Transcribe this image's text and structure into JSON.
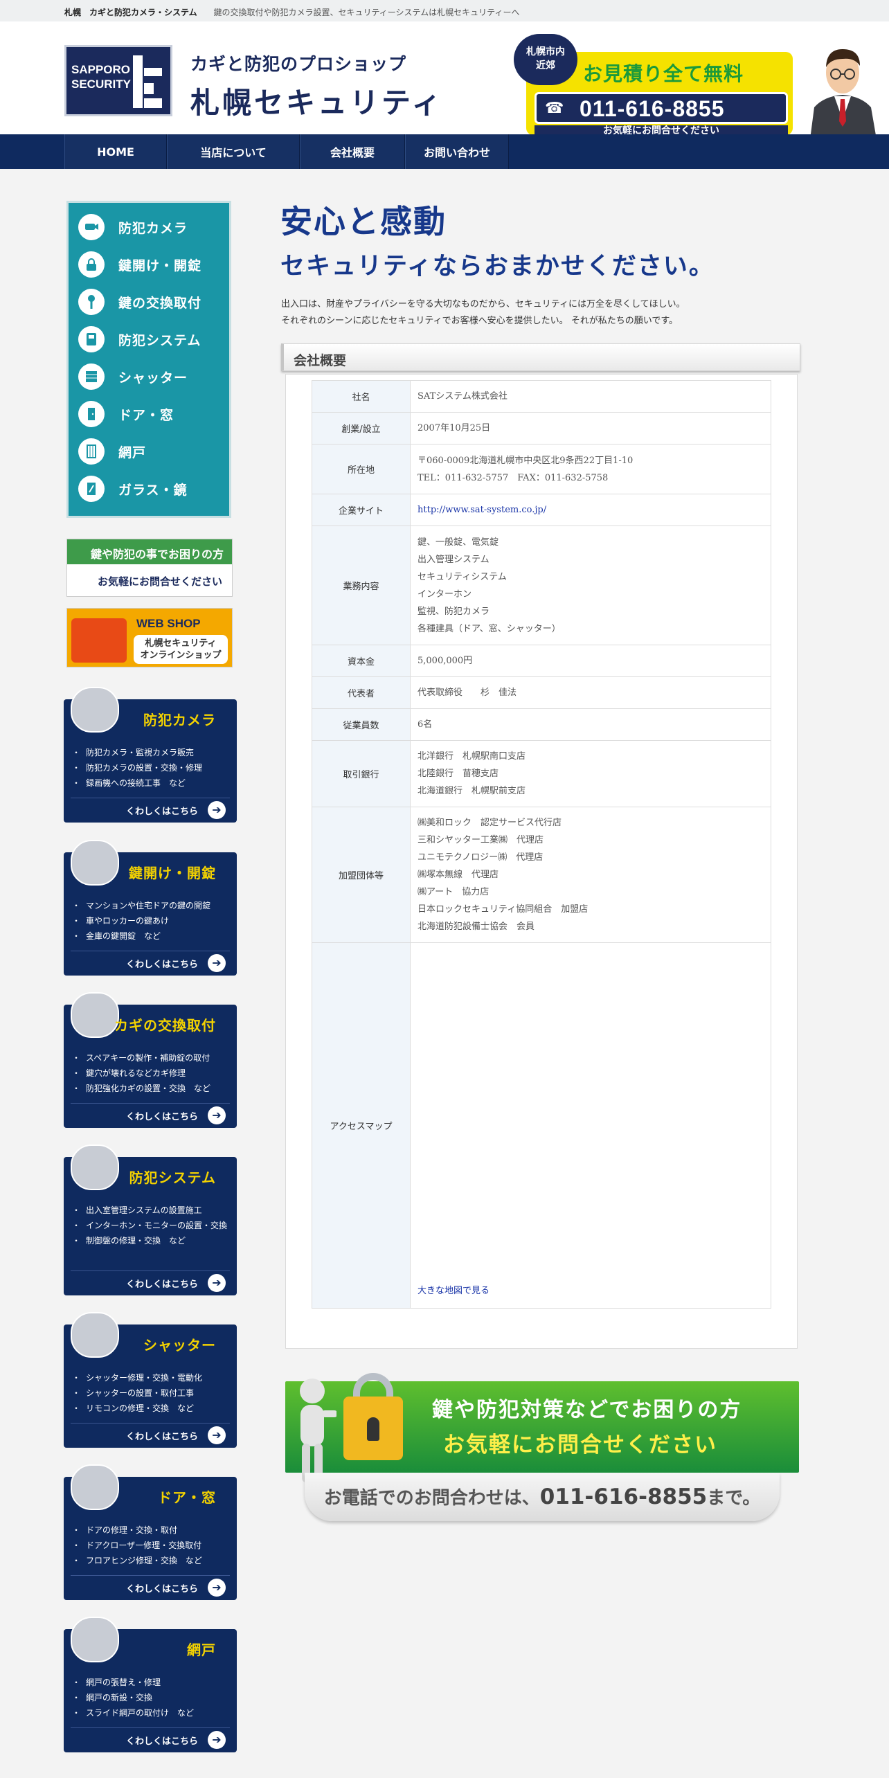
{
  "topbar": {
    "brand": "札幌　カギと防犯カメラ・システム",
    "desc": "鍵の交換取付や防犯カメラ設置、セキュリティーシステムは札幌セキュリティーへ"
  },
  "header": {
    "logo_line1": "SAPPORO",
    "logo_line2": "SECURITY",
    "tagline": "カギと防犯のプロショップ",
    "shop_name": "札幌セキュリティ",
    "area_line1": "札幌市内",
    "area_line2": "近郊",
    "estimate": "お見積り全て無料",
    "phone": "011-616-8855",
    "contact_note": "お気軽にお問合せください"
  },
  "nav": [
    {
      "label": "HOME"
    },
    {
      "label": "当店について"
    },
    {
      "label": "会社概要"
    },
    {
      "label": "お問い合わせ"
    }
  ],
  "side_menu": [
    {
      "label": "防犯カメラ",
      "icon": "camera-icon"
    },
    {
      "label": "鍵開け・開錠",
      "icon": "lock-icon"
    },
    {
      "label": "鍵の交換取付",
      "icon": "key-icon"
    },
    {
      "label": "防犯システム",
      "icon": "intercom-icon"
    },
    {
      "label": "シャッター",
      "icon": "shutter-icon"
    },
    {
      "label": "ドア・窓",
      "icon": "door-icon"
    },
    {
      "label": "網戸",
      "icon": "screen-icon"
    },
    {
      "label": "ガラス・鏡",
      "icon": "glass-icon"
    }
  ],
  "banners": {
    "trouble_title": "鍵や防犯の事でお困りの方",
    "trouble_text": "お気軽にお問合せください",
    "shop_title": "WEB SHOP",
    "shop_sub1": "札幌セキュリティ",
    "shop_sub2": "オンラインショップ"
  },
  "services": [
    {
      "title": "防犯カメラ",
      "items": [
        "防犯カメラ・監視カメラ販売",
        "防犯カメラの設置・交換・修理",
        "録画機への接続工事　など"
      ],
      "more": "くわしくはこちら"
    },
    {
      "title": "鍵開け・開錠",
      "items": [
        "マンションや住宅ドアの鍵の開錠",
        "車やロッカーの鍵あけ",
        "金庫の鍵開錠　など"
      ],
      "more": "くわしくはこちら"
    },
    {
      "title": "カギの交換取付",
      "items": [
        "スペアキーの製作・補助錠の取付",
        "鍵穴が壊れるなどカギ修理",
        "防犯強化カギの設置・交換　など"
      ],
      "more": "くわしくはこちら"
    },
    {
      "title": "防犯システム",
      "items": [
        "出入室管理システムの設置施工",
        "インターホン・モニターの設置・交換",
        "制御盤の修理・交換　など"
      ],
      "more": "くわしくはこちら"
    },
    {
      "title": "シャッター",
      "items": [
        "シャッター修理・交換・電動化",
        "シャッターの設置・取付工事",
        "リモコンの修理・交換　など"
      ],
      "more": "くわしくはこちら"
    },
    {
      "title": "ドア・窓",
      "items": [
        "ドアの修理・交換・取付",
        "ドアクローザー修理・交換取付",
        "フロアヒンジ修理・交換　など"
      ],
      "more": "くわしくはこちら"
    },
    {
      "title": "網戸",
      "items": [
        "網戸の張替え・修理",
        "網戸の新設・交換",
        "スライド網戸の取付け　など"
      ],
      "more": "くわしくはこちら"
    }
  ],
  "main": {
    "heading": "安心と感動",
    "subheading": "セキュリティならおまかせください。",
    "intro1": "出入口は、財産やプライバシーを守る大切なものだから、セキュリティには万全を尽くしてほしい。",
    "intro2": "それぞれのシーンに応じたセキュリティでお客様へ安心を提供したい。 それが私たちの願いです。",
    "section_title": "会社概要"
  },
  "company": {
    "name": {
      "label": "社名",
      "value": "SATシステム株式会社"
    },
    "founded": {
      "label": "創業/設立",
      "value": "2007年10月25日"
    },
    "address": {
      "label": "所在地",
      "line1": "〒060-0009北海道札幌市中央区北9条西22丁目1-10",
      "line2": "TEL：011-632-5757　FAX：011-632-5758"
    },
    "site": {
      "label": "企業サイト",
      "value": "http://www.sat-system.co.jp/"
    },
    "business": {
      "label": "業務内容",
      "lines": [
        "鍵、一般錠、電気錠",
        "出入管理システム",
        "セキュリティシステム",
        "インターホン",
        "監視、防犯カメラ",
        "各種建具（ドア、窓、シャッター）"
      ]
    },
    "capital": {
      "label": "資本金",
      "value": "5,000,000円"
    },
    "rep": {
      "label": "代表者",
      "value": "代表取締役　　杉　佳法"
    },
    "employees": {
      "label": "従業員数",
      "value": "6名"
    },
    "banks": {
      "label": "取引銀行",
      "lines": [
        "北洋銀行　札幌駅南口支店",
        "北陸銀行　苗穂支店",
        "北海道銀行　札幌駅前支店"
      ]
    },
    "groups": {
      "label": "加盟団体等",
      "lines": [
        "㈱美和ロック　認定サービス代行店",
        "三和シヤッター工業㈱　代理店",
        "ユニモテクノロジー㈱　代理店",
        "㈱塚本無線　代理店",
        "㈱アート　協力店",
        "日本ロックセキュリティ協同組合　加盟店",
        "北海道防犯設備士協会　会員"
      ]
    },
    "map": {
      "label": "アクセスマップ",
      "link": "大きな地図で見る"
    }
  },
  "bottom_banner": {
    "line1": "鍵や防犯対策などでお困りの方",
    "line2": "お気軽にお問合せください",
    "phone_pre": "お電話でのお問合わせは、",
    "phone": "011-616-8855",
    "phone_post": "まで。"
  }
}
